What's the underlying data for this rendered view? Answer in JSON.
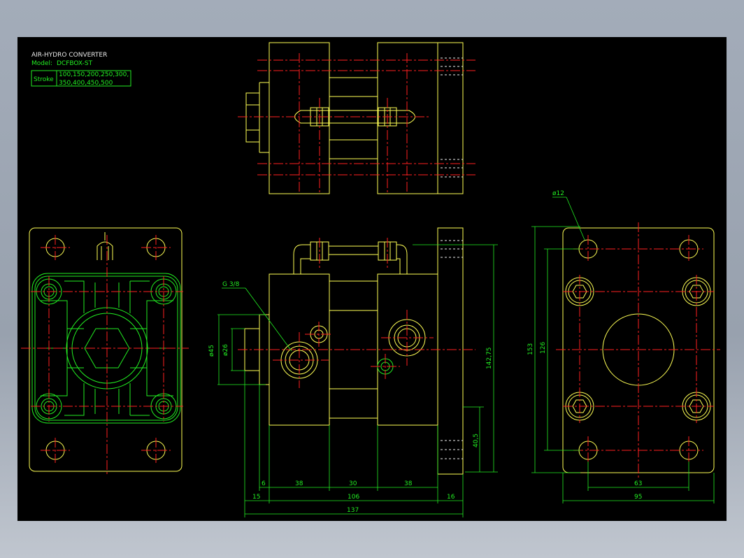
{
  "title_block": {
    "title": "AIR-HYDRO CONVERTER",
    "model_label": "Model:",
    "model_value": "DCFBOX-ST",
    "stroke_label": "Stroke",
    "stroke_values_line1": "100,150,200,250,300,",
    "stroke_values_line2": "350,400,450,500"
  },
  "annotations": {
    "thread_port": "G 3/8",
    "hole_dia": "ø12"
  },
  "dimensions": {
    "d45": "ø45",
    "d26": "ø26",
    "h142_75": "142,75",
    "h40_5": "40,5",
    "w6": "6",
    "w38a": "38",
    "w30": "30",
    "w38b": "38",
    "w15": "15",
    "w106": "106",
    "w16": "16",
    "w137": "137",
    "h153": "153",
    "h126": "126",
    "w63": "63",
    "w95": "95"
  },
  "colors": {
    "background": "#000000",
    "outline": "#ffff55",
    "dimension": "#22ee22",
    "centerline": "#ff2020",
    "hidden": "#f0f0f0"
  }
}
